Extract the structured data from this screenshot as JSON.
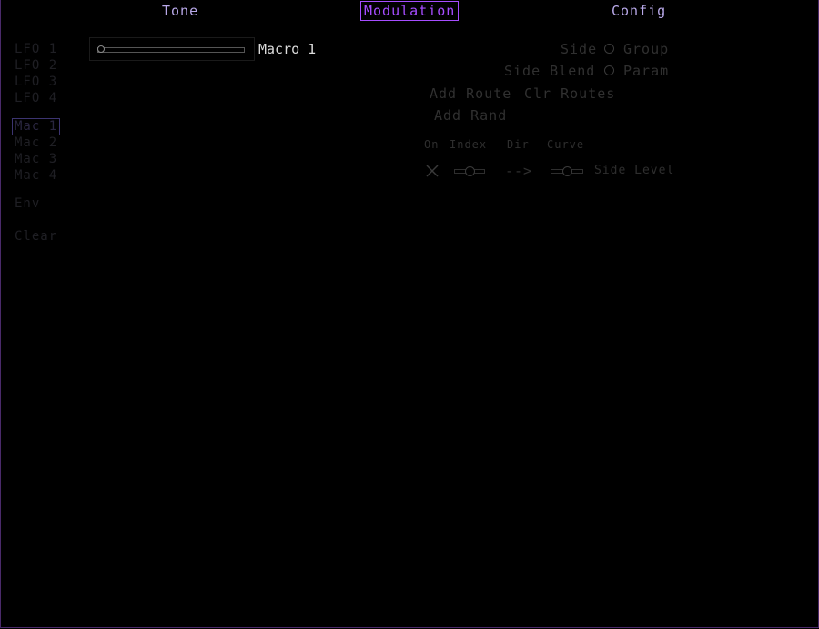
{
  "tabs": [
    {
      "label": "Tone",
      "active": false
    },
    {
      "label": "Modulation",
      "active": true
    },
    {
      "label": "Config",
      "active": false
    }
  ],
  "sidebar": {
    "lfos": [
      "LFO 1",
      "LFO 2",
      "LFO 3",
      "LFO 4"
    ],
    "macros": [
      "Mac 1",
      "Mac 2",
      "Mac 3",
      "Mac 4"
    ],
    "selected": "Mac 1",
    "env": "Env",
    "clear": "Clear"
  },
  "macro": {
    "label": "Macro 1",
    "value": 0.0
  },
  "right_panel": {
    "side_label": "Side",
    "group_label": "Group",
    "side_blend_label": "Side Blend",
    "param_label": "Param",
    "add_route": "Add Route",
    "clr_routes": "Clr Routes",
    "add_rand": "Add Rand",
    "headers": {
      "on": "On",
      "index": "Index",
      "dir": "Dir",
      "curve": "Curve"
    },
    "route": {
      "enabled_icon": "x-icon",
      "index_value": 0.5,
      "direction": "-->",
      "curve_value": 0.5,
      "target": "Side Level"
    }
  },
  "colors": {
    "accent": "#a64dff",
    "tab_text": "#b8a8e8",
    "divider": "#6a3aa0",
    "dim_text": "#303030"
  }
}
